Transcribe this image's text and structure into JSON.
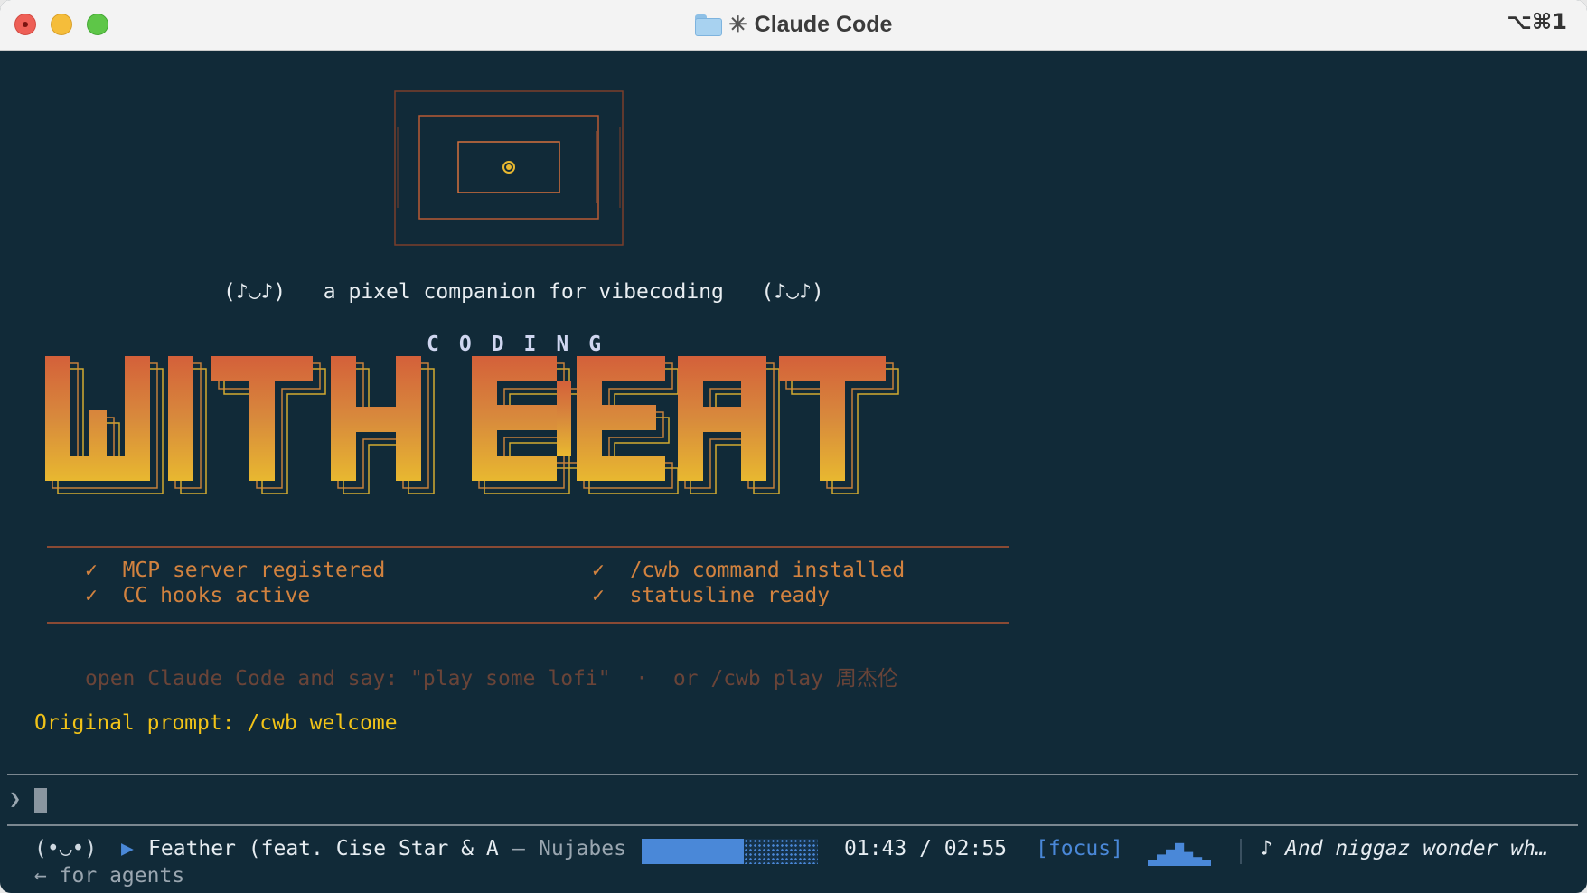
{
  "window": {
    "title": "Claude Code",
    "title_glyph": "✳",
    "shortcut": "⌥⌘1",
    "folder_icon": "folder-icon"
  },
  "splash": {
    "tagline": "(♪◡♪)   a pixel companion for vibecoding   (♪◡♪)",
    "coding_label": "CODING",
    "title_word1": "WITH",
    "title_word2": "BEAT",
    "checks": [
      {
        "mark": "✓",
        "text": "MCP server registered"
      },
      {
        "mark": "✓",
        "text": "CC hooks active"
      },
      {
        "mark": "✓",
        "text": "/cwb command installed"
      },
      {
        "mark": "✓",
        "text": "statusline ready"
      }
    ],
    "hint": "open Claude Code and say: \"play some lofi\"  ·  or /cwb play 周杰伦",
    "original_prompt": "Original prompt: /cwb welcome"
  },
  "prompt": {
    "caret": "❯",
    "value": ""
  },
  "status": {
    "face": "(•◡•)",
    "play_glyph": "▶",
    "track": "Feather (feat. Cise Star & A",
    "dash": "—",
    "artist": "Nujabes",
    "progress_fraction": 0.58,
    "time": "01:43 / 02:55",
    "mode": "[focus]",
    "lyric_glyph": "♪",
    "lyric": "And niggaz wonder wh…",
    "agents_hint": "← for agents",
    "equalizer_levels": [
      0.25,
      0.45,
      0.65,
      0.9,
      0.55,
      0.35,
      0.25
    ],
    "accent_color": "#4a88d8"
  },
  "colors": {
    "background": "#112a38",
    "check": "#d2823f",
    "prompt_yellow": "#f2c318",
    "gradient_top": "#d4603a",
    "gradient_bottom": "#e8b830"
  }
}
